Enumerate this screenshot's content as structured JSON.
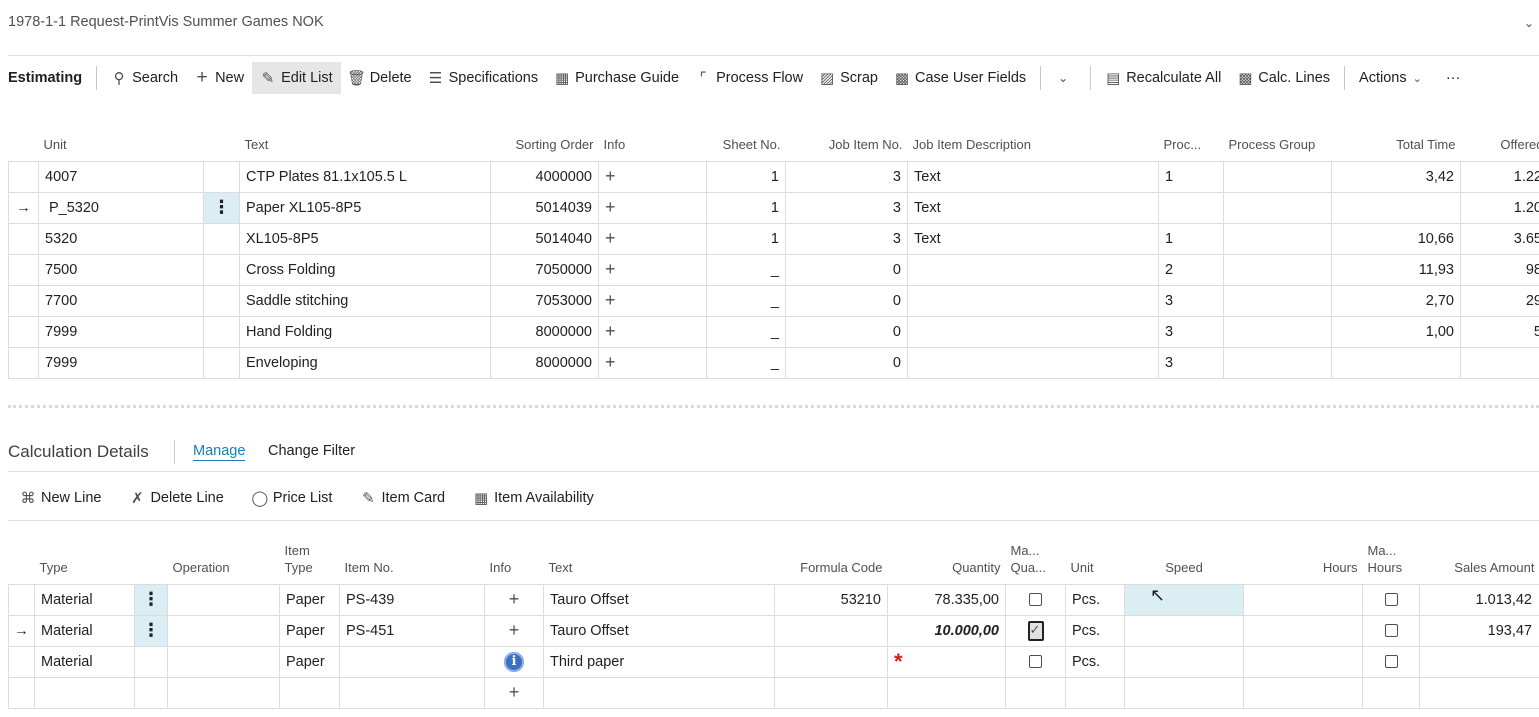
{
  "page_title": "1978-1-1 Request-PrintVis Summer Games NOK",
  "toolbar": {
    "title": "Estimating",
    "buttons": [
      {
        "label": "Search",
        "icon": "search-icon"
      },
      {
        "label": "New",
        "icon": "plus-icon"
      },
      {
        "label": "Edit List",
        "icon": "edit-list-icon"
      },
      {
        "label": "Delete",
        "icon": "trash-icon"
      },
      {
        "label": "Specifications",
        "icon": "checklist-icon"
      },
      {
        "label": "Purchase Guide",
        "icon": "table-icon"
      },
      {
        "label": "Process Flow",
        "icon": "flow-icon"
      },
      {
        "label": "Scrap",
        "icon": "scrap-icon"
      },
      {
        "label": "Case User Fields",
        "icon": "user-fields-icon"
      },
      {
        "label": "Recalculate All",
        "icon": "recalculate-icon"
      },
      {
        "label": "Calc. Lines",
        "icon": "calc-lines-icon"
      }
    ],
    "actions_label": "Actions",
    "more_label": "···"
  },
  "estimating_grid": {
    "columns": {
      "unit": "Unit",
      "text": "Text",
      "sorting_order": "Sorting Order",
      "info": "Info",
      "sheet_no": "Sheet No.",
      "job_item_no": "Job Item No.",
      "job_item_description": "Job Item Description",
      "proc": "Proc...",
      "process_group": "Process Group",
      "total_time": "Total Time",
      "offered": "Offered"
    },
    "rows": [
      {
        "unit": "4007",
        "text": "CTP Plates 81.1x105.5 L",
        "sorting_order": "4000000",
        "sheet_no": "1",
        "job_item_no": "3",
        "job_item_description": "Text",
        "proc": "1",
        "process_group": "",
        "total_time": "3,42",
        "offered": "1.22"
      },
      {
        "unit": "P_5320",
        "text": "Paper XL105-8P5",
        "sorting_order": "5014039",
        "sheet_no": "1",
        "job_item_no": "3",
        "job_item_description": "Text",
        "proc": "",
        "process_group": "",
        "total_time": "",
        "offered": "1.20",
        "current": true
      },
      {
        "unit": "5320",
        "text": "XL105-8P5",
        "sorting_order": "5014040",
        "sheet_no": "1",
        "job_item_no": "3",
        "job_item_description": "Text",
        "proc": "1",
        "process_group": "",
        "total_time": "10,66",
        "offered": "3.65"
      },
      {
        "unit": "7500",
        "text": "Cross Folding",
        "sorting_order": "7050000",
        "sheet_no": "_",
        "job_item_no": "0",
        "job_item_description": "",
        "proc": "2",
        "process_group": "",
        "total_time": "11,93",
        "offered": "98"
      },
      {
        "unit": "7700",
        "text": "Saddle stitching",
        "sorting_order": "7053000",
        "sheet_no": "_",
        "job_item_no": "0",
        "job_item_description": "",
        "proc": "3",
        "process_group": "",
        "total_time": "2,70",
        "offered": "29"
      },
      {
        "unit": "7999",
        "text": "Hand Folding",
        "sorting_order": "8000000",
        "sheet_no": "_",
        "job_item_no": "0",
        "job_item_description": "",
        "proc": "3",
        "process_group": "",
        "total_time": "1,00",
        "offered": "5"
      },
      {
        "unit": "7999",
        "text": "Enveloping",
        "sorting_order": "8000000",
        "sheet_no": "_",
        "job_item_no": "0",
        "job_item_description": "",
        "proc": "3",
        "process_group": "",
        "total_time": "",
        "offered": ""
      }
    ]
  },
  "calc_section": {
    "title": "Calculation Details",
    "tabs": [
      "Manage",
      "Change Filter"
    ],
    "actions": [
      {
        "label": "New Line",
        "icon": "new-line-icon"
      },
      {
        "label": "Delete Line",
        "icon": "delete-line-icon"
      },
      {
        "label": "Price List",
        "icon": "price-list-icon"
      },
      {
        "label": "Item Card",
        "icon": "pencil-icon"
      },
      {
        "label": "Item Availability",
        "icon": "availability-icon"
      }
    ]
  },
  "calc_grid": {
    "columns": {
      "type": "Type",
      "operation": "Operation",
      "item_type": "Item Type",
      "item_no": "Item No.",
      "info": "Info",
      "text": "Text",
      "formula_code": "Formula Code",
      "quantity": "Quantity",
      "manual_qty": "Ma... Qua...",
      "unit": "Unit",
      "speed": "Speed",
      "hours": "Hours",
      "manual_hours": "Ma... Hours",
      "sales_amount": "Sales Amount"
    },
    "rows": [
      {
        "type": "Material",
        "operation": "",
        "item_type": "Paper",
        "item_no": "PS-439",
        "text": "Tauro Offset",
        "formula_code": "53210",
        "quantity": "78.335,00",
        "unit": "Pcs.",
        "speed": "",
        "hours": "",
        "sales_amount": "1.013,42"
      },
      {
        "type": "Material",
        "operation": "",
        "item_type": "Paper",
        "item_no": "PS-451",
        "text": "Tauro Offset",
        "formula_code": "",
        "quantity": "10.000,00",
        "unit": "Pcs.",
        "speed": "",
        "hours": "",
        "sales_amount": "193,47",
        "current": true
      },
      {
        "type": "Material",
        "operation": "",
        "item_type": "Paper",
        "item_no": "",
        "text": "Third paper",
        "formula_code": "",
        "quantity": "",
        "unit": "Pcs.",
        "speed": "",
        "hours": "",
        "sales_amount": ""
      }
    ]
  }
}
